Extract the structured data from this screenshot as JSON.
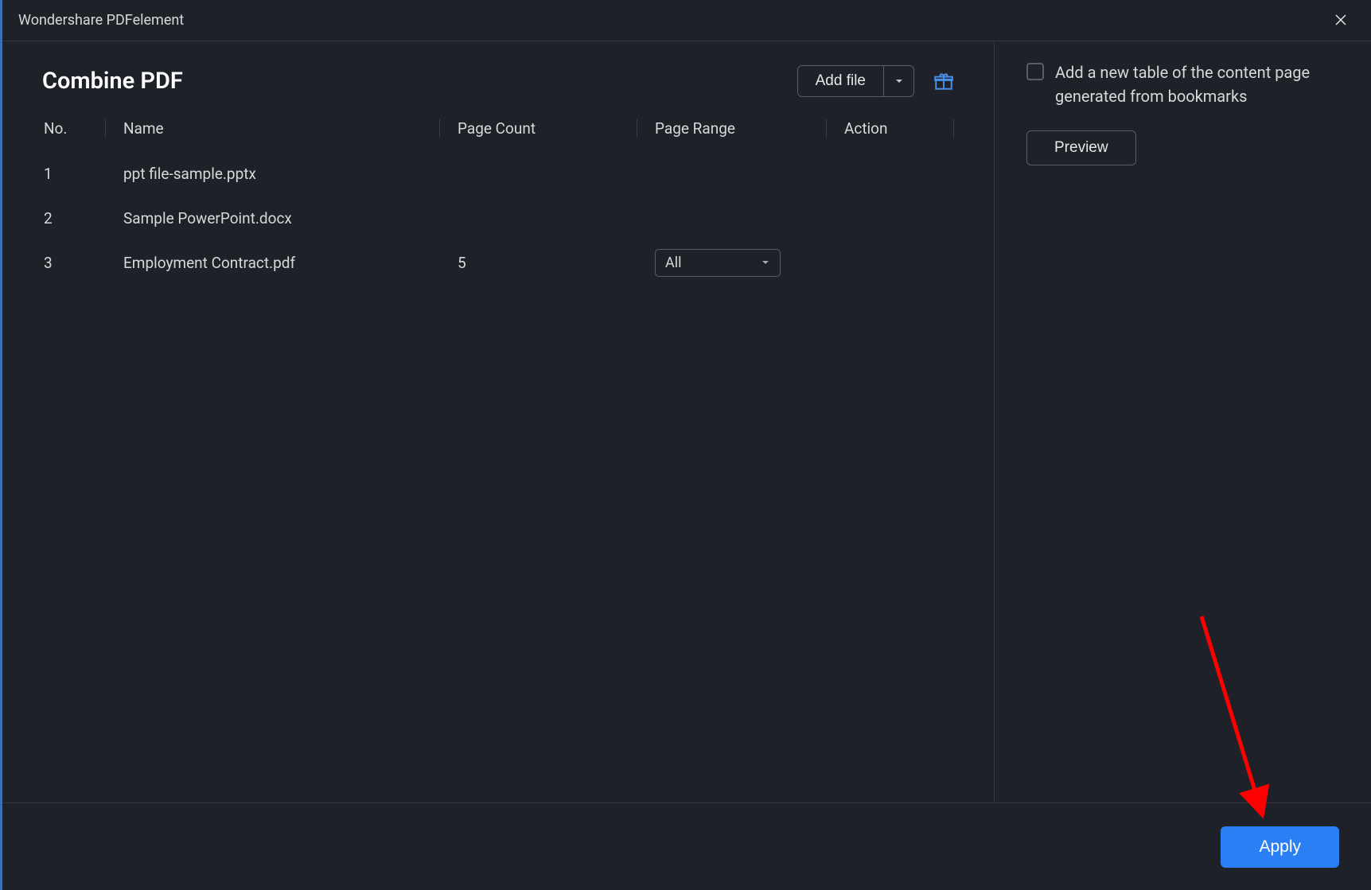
{
  "window": {
    "title": "Wondershare PDFelement"
  },
  "page": {
    "title": "Combine PDF"
  },
  "toolbar": {
    "add_file_label": "Add file"
  },
  "table": {
    "headers": {
      "no": "No.",
      "name": "Name",
      "page_count": "Page Count",
      "page_range": "Page Range",
      "action": "Action"
    },
    "rows": [
      {
        "no": "1",
        "name": "ppt file-sample.pptx",
        "page_count": "",
        "page_range": null
      },
      {
        "no": "2",
        "name": "Sample PowerPoint.docx",
        "page_count": "",
        "page_range": null
      },
      {
        "no": "3",
        "name": "Employment Contract.pdf",
        "page_count": "5",
        "page_range": "All"
      }
    ]
  },
  "sidebar": {
    "toc_checkbox_label": "Add a new table of the content page generated from bookmarks",
    "toc_checkbox_checked": false,
    "preview_label": "Preview"
  },
  "footer": {
    "apply_label": "Apply"
  }
}
